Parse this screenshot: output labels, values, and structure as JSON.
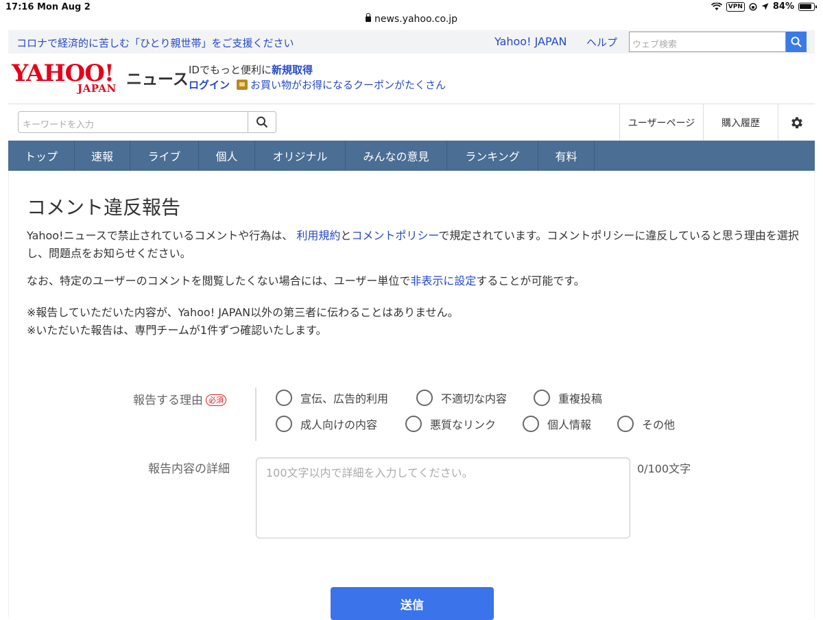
{
  "status": {
    "time": "17:16",
    "date": "Mon Aug 2",
    "vpn": "VPN",
    "battery": "84%"
  },
  "browser": {
    "url": "news.yahoo.co.jp"
  },
  "promo": {
    "text": "コロナで経済的に苦しむ「ひとり親世帯」をご支援ください",
    "yahoo_japan": "Yahoo! JAPAN",
    "help": "ヘルプ",
    "web_search_placeholder": "ウェブ検索"
  },
  "header": {
    "logo_text": "YAHOO!",
    "logo_sub": "JAPAN",
    "news_label": "ニュース",
    "id_prefix": "IDでもっと便利に",
    "new_signup": "新規取得",
    "login": "ログイン",
    "coupon_text": "お買い物がお得になるクーポンがたくさん"
  },
  "search": {
    "placeholder": "キーワードを入力",
    "user_page": "ユーザーページ",
    "purchase_history": "購入履歴"
  },
  "nav": {
    "tabs": [
      {
        "label": "トップ"
      },
      {
        "label": "速報"
      },
      {
        "label": "ライブ"
      },
      {
        "label": "個人"
      },
      {
        "label": "オリジナル"
      },
      {
        "label": "みんなの意見"
      },
      {
        "label": "ランキング"
      },
      {
        "label": "有料"
      }
    ]
  },
  "main": {
    "title": "コメント違反報告",
    "p1_a": "Yahoo!ニュースで禁止されているコメントや行為は、 ",
    "p1_link1": "利用規約",
    "p1_b": "と",
    "p1_link2": "コメントポリシー",
    "p1_c": "で規定されています。コメントポリシーに違反していると思う理由を選択し、問題点をお知らせください。",
    "p2_a": "なお、特定のユーザーのコメントを閲覧したくない場合には、ユーザー単位で",
    "p2_link": "非表示に設定",
    "p2_b": "することが可能です。",
    "note1": "※報告していただいた内容が、Yahoo! JAPAN以外の第三者に伝わることはありません。",
    "note2": "※いただいた報告は、専門チームが1件ずつ確認いたします。"
  },
  "form": {
    "reason_label": "報告する理由",
    "required": "必須",
    "reasons": [
      "宣伝、広告的利用",
      "不適切な内容",
      "重複投稿",
      "成人向けの内容",
      "悪質なリンク",
      "個人情報",
      "その他"
    ],
    "detail_label": "報告内容の詳細",
    "detail_placeholder": "100文字以内で詳細を入力してください。",
    "counter": "0/100文字",
    "submit": "送信"
  }
}
